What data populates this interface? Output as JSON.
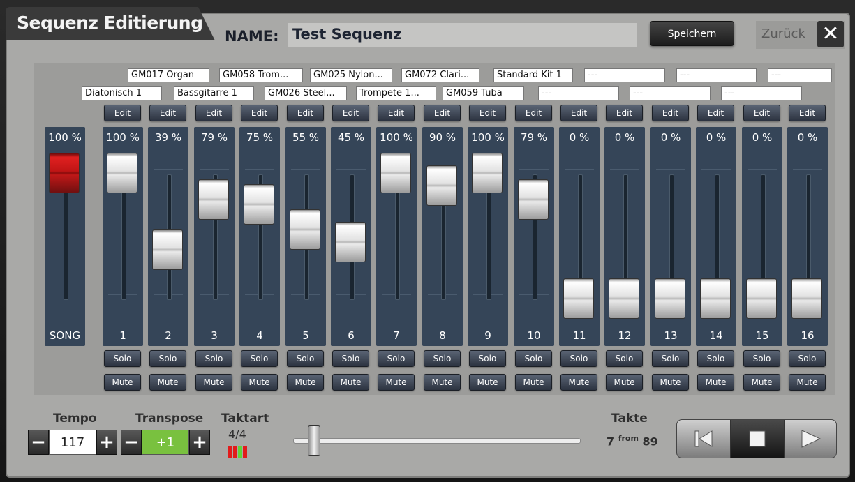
{
  "header": {
    "title": "Sequenz Editierung",
    "name_label": "NAME:",
    "name_value": "Test Sequenz",
    "save_label": "Speichern",
    "back_label": "Zurück",
    "close_glyph": "✕"
  },
  "instruments_row1": [
    "GM017 Organ",
    "GM058 Trom...",
    "GM025 Nylon...",
    "GM072 Clari...",
    "Standard Kit 1",
    "---",
    "---",
    "---"
  ],
  "instruments_row2": [
    "Diatonisch 1",
    "Bassgitarre 1",
    "GM026 Steel...",
    "Trompete 1...",
    "GM059 Tuba",
    "---",
    "---",
    "---"
  ],
  "edit_label": "Edit",
  "solo_label": "Solo",
  "mute_label": "Mute",
  "song_fader": {
    "label": "SONG",
    "percent_text": "100 %",
    "level": 1.0
  },
  "channels": [
    {
      "num": "1",
      "percent_text": "100 %",
      "level": 1.0
    },
    {
      "num": "2",
      "percent_text": "39 %",
      "level": 0.39
    },
    {
      "num": "3",
      "percent_text": "79 %",
      "level": 0.79
    },
    {
      "num": "4",
      "percent_text": "75 %",
      "level": 0.75
    },
    {
      "num": "5",
      "percent_text": "55 %",
      "level": 0.55
    },
    {
      "num": "6",
      "percent_text": "45 %",
      "level": 0.45
    },
    {
      "num": "7",
      "percent_text": "100 %",
      "level": 1.0
    },
    {
      "num": "8",
      "percent_text": "90 %",
      "level": 0.9
    },
    {
      "num": "9",
      "percent_text": "100 %",
      "level": 1.0
    },
    {
      "num": "10",
      "percent_text": "79 %",
      "level": 0.79
    },
    {
      "num": "11",
      "percent_text": "0 %",
      "level": 0.0
    },
    {
      "num": "12",
      "percent_text": "0 %",
      "level": 0.0
    },
    {
      "num": "13",
      "percent_text": "0 %",
      "level": 0.0
    },
    {
      "num": "14",
      "percent_text": "0 %",
      "level": 0.0
    },
    {
      "num": "15",
      "percent_text": "0 %",
      "level": 0.0
    },
    {
      "num": "16",
      "percent_text": "0 %",
      "level": 0.0
    }
  ],
  "bottom": {
    "tempo_label": "Tempo",
    "tempo_value": "117",
    "transpose_label": "Transpose",
    "transpose_value": "+1",
    "taktart_label": "Taktart",
    "taktart_value": "4/4",
    "minus_glyph": "−",
    "plus_glyph": "+",
    "position_fraction": 0.05,
    "takte_label": "Takte",
    "takte_current": "7",
    "takte_from": "from",
    "takte_total": "89"
  },
  "colors": {
    "panel_bg": "#a9a9a7",
    "strip_bg": "#354558",
    "transpose_green": "#79c13f",
    "song_fader_red": "#c01515",
    "beat_red": "#e21b1b",
    "beat_green": "#5fd23a"
  },
  "icons": {
    "close": "close-icon",
    "rewind": "skip-back-icon",
    "stop": "stop-icon",
    "play": "play-icon"
  }
}
